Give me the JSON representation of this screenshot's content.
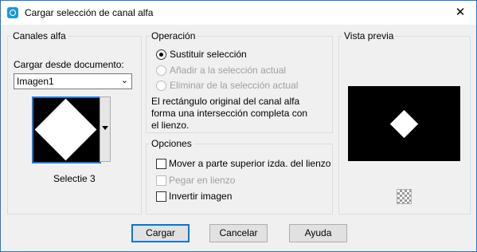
{
  "window": {
    "title": "Cargar selección de canal alfa",
    "close_glyph": "✕"
  },
  "canales": {
    "group_label": "Canales alfa",
    "load_label": "Cargar desde documento:",
    "document_value": "Imagen1",
    "selection_name": "Selectie 3"
  },
  "operacion": {
    "group_label": "Operación",
    "options": [
      {
        "label": "Sustituir selección",
        "selected": true,
        "enabled": true
      },
      {
        "label": "Añadir a la selección actual",
        "selected": false,
        "enabled": false
      },
      {
        "label": "Eliminar de la selección actual",
        "selected": false,
        "enabled": false
      }
    ],
    "description": "El rectángulo original del canal alfa forma una intersección completa con el lienzo."
  },
  "opciones": {
    "group_label": "Opciones",
    "items": [
      {
        "label": "Mover a parte superior izda. del lienzo",
        "checked": false,
        "enabled": true
      },
      {
        "label": "Pegar en lienzo",
        "checked": false,
        "enabled": false
      },
      {
        "label": "Invertir imagen",
        "checked": false,
        "enabled": true
      }
    ]
  },
  "preview": {
    "group_label": "Vista previa"
  },
  "buttons": {
    "load": "Cargar",
    "cancel": "Cancelar",
    "help": "Ayuda"
  },
  "icons": {
    "app": "app-selection-icon",
    "transparency": "checkerboard-icon"
  },
  "colors": {
    "accent": "#1e78d7",
    "titlebar": "#ffffff",
    "dialog_bg": "#f0f0f0"
  }
}
